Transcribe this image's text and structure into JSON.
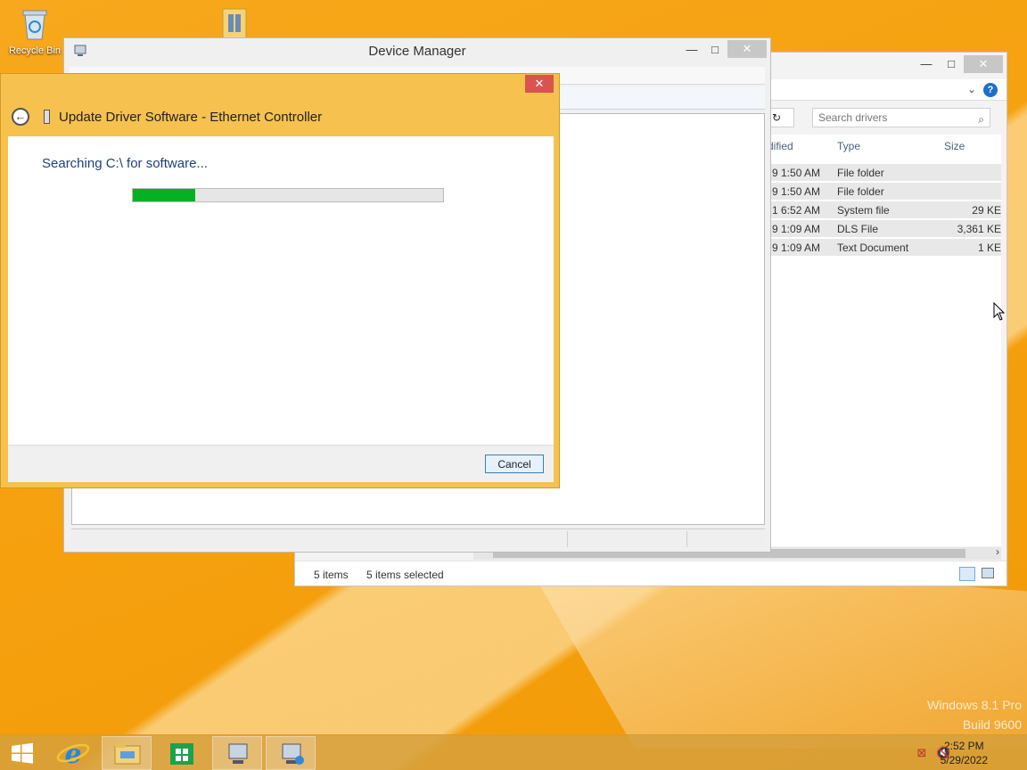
{
  "desktop": {
    "recycle_bin_label": "Recycle Bin"
  },
  "explorer": {
    "title_controls": {
      "minimize": "—",
      "maximize": "□",
      "close": "✕"
    },
    "search_placeholder": "Search drivers",
    "columns": {
      "modified": "dified",
      "type": "Type",
      "size": "Size"
    },
    "rows": [
      {
        "modified": "9 1:50 AM",
        "type": "File folder",
        "size": ""
      },
      {
        "modified": "9 1:50 AM",
        "type": "File folder",
        "size": ""
      },
      {
        "modified": "1 6:52 AM",
        "type": "System file",
        "size": "29 KE"
      },
      {
        "modified": "9 1:09 AM",
        "type": "DLS File",
        "size": "3,361 KE"
      },
      {
        "modified": "9 1:09 AM",
        "type": "Text Document",
        "size": "1 KE"
      }
    ],
    "status": {
      "items": "5 items",
      "selected": "5 items selected"
    }
  },
  "device_manager": {
    "title": "Device Manager",
    "controls": {
      "minimize": "—",
      "maximize": "□",
      "close": "✕"
    }
  },
  "dialog": {
    "title": "Update Driver Software - Ethernet Controller",
    "status_text": "Searching C:\\ for software...",
    "progress_percent": 20,
    "cancel_label": "Cancel",
    "close_label": "✕"
  },
  "watermark": {
    "line1": "Windows 8.1 Pro",
    "line2": "Build 9600"
  },
  "taskbar": {
    "time": "2:52 PM",
    "date": "5/29/2022"
  },
  "colors": {
    "progress_fill": "#06b025",
    "dialog_frame": "#f6c14f",
    "close_red": "#d9534f"
  }
}
